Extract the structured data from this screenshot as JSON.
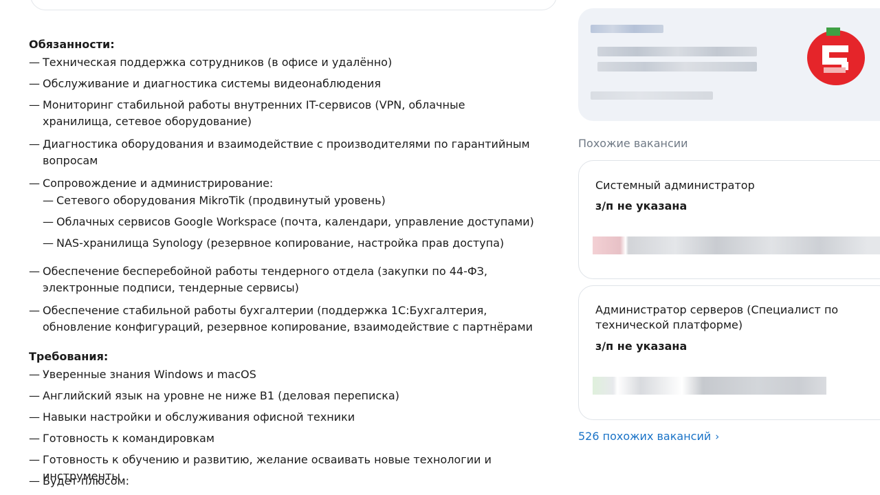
{
  "description": {
    "duties_title": "Обязанности:",
    "duties": [
      "Техническая поддержка сотрудников (в офисе и удалённо)",
      "Обслуживание и диагностика системы видеонаблюдения",
      "Мониторинг стабильной работы внутренних IT-сервисов (VPN, облачные хранилища, сетевое оборудование)",
      "Диагностика оборудования и взаимодействие с производителями по гарантийным вопросам",
      "Сопровождение и администрирование:"
    ],
    "admin_items": [
      "Сетевого оборудования MikroTik (продвинутый уровень)",
      "Облачных сервисов Google Workspace (почта, календари, управление доступами)",
      "NAS-хранилища Synology (резервное копирование, настройка прав доступа)"
    ],
    "duties_more": [
      "Обеспечение бесперебойной работы тендерного отдела (закупки по 44-ФЗ, электронные подписи, тендерные сервисы)",
      "Обеспечение стабильной работы бухгалтерии (поддержка 1С:Бухгалтерия, обновление конфигураций, резервное копирование, взаимодействие с партнёрами"
    ],
    "requirements_title": "Требования:",
    "requirements": [
      "Уверенные знания Windows и macOS",
      "Английский язык на уровне не ниже B1 (деловая переписка)",
      "Навыки настройки и обслуживания офисной техники",
      "Готовность к командировкам",
      "Готовность к обучению и развитию, желание осваивать новые технологии и инструменты",
      "Будет плюсом:"
    ]
  },
  "sidebar": {
    "similar_header": "Похожие вакансии",
    "vacancies": [
      {
        "title": "Системный администратор",
        "salary": "з/п не указана"
      },
      {
        "title": "Администратор серверов (Специалист по технической платформе)",
        "salary": "з/п не указана"
      }
    ],
    "more_link": "526 похожих вакансий",
    "link_color": "#1a73c7"
  }
}
